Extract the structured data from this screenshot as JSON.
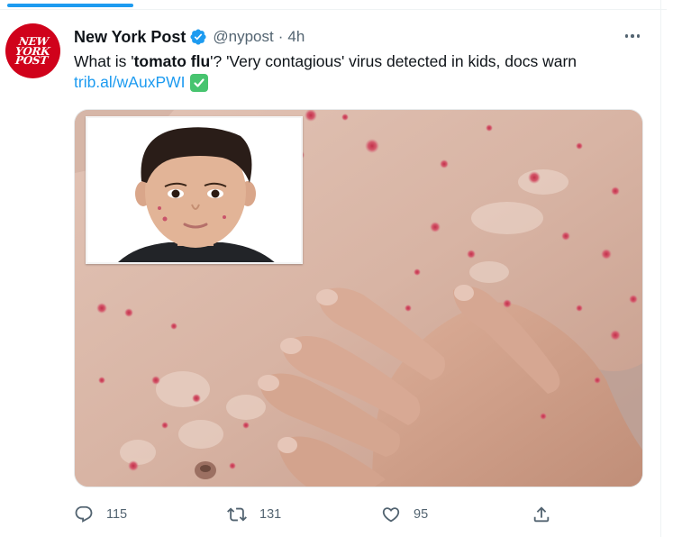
{
  "tweet": {
    "author": {
      "name": "New York Post",
      "handle": "@nypost",
      "time": "4h",
      "separator": "·",
      "avatar_lines": [
        "NEW",
        "YORK",
        "POST"
      ],
      "verified": true
    },
    "text_prefix": "What is '",
    "text_bold": "tomato flu",
    "text_suffix": "'? 'Very contagious' virus detected in kids, docs warn",
    "link": "trib.al/wAuxPWI",
    "link_emoji": "check-mark-button-icon",
    "media_description_icon": "photo"
  },
  "actions": {
    "reply": {
      "icon": "reply-icon",
      "count": "115"
    },
    "retweet": {
      "icon": "retweet-icon",
      "count": "131"
    },
    "like": {
      "icon": "heart-icon",
      "count": "95"
    },
    "share": {
      "icon": "share-icon"
    }
  },
  "colors": {
    "accent": "#1d9bf0",
    "avatar_red": "#d0021b",
    "text": "#0f1419",
    "secondary": "#536471",
    "verified_emoji_green": "#47c46f"
  }
}
